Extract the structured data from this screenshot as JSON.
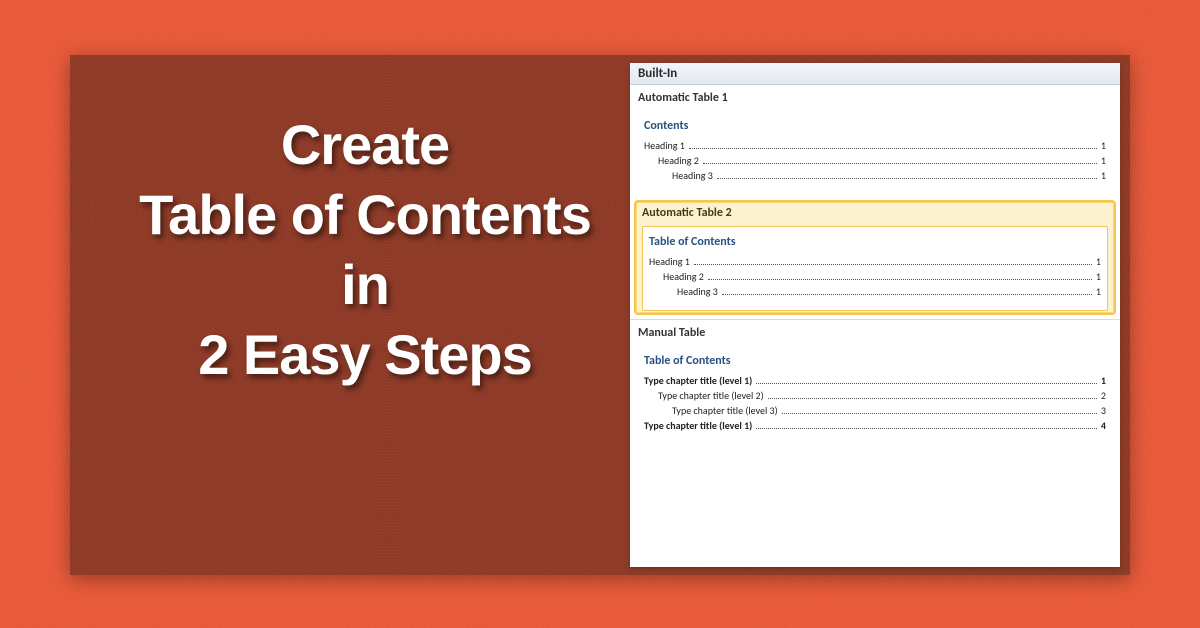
{
  "headline": {
    "l1": "Create",
    "l2": "Table of Contents",
    "l3": "in",
    "l4": "2 Easy Steps"
  },
  "gallery": {
    "header": "Built-In",
    "styles": [
      {
        "title": "Automatic Table 1",
        "preview_title": "Contents",
        "lines": [
          {
            "text": "Heading 1",
            "page": "1",
            "indent": 0,
            "bold": false
          },
          {
            "text": "Heading 2",
            "page": "1",
            "indent": 1,
            "bold": false
          },
          {
            "text": "Heading 3",
            "page": "1",
            "indent": 2,
            "bold": false
          }
        ],
        "selected": false
      },
      {
        "title": "Automatic Table 2",
        "preview_title": "Table of Contents",
        "lines": [
          {
            "text": "Heading 1",
            "page": "1",
            "indent": 0,
            "bold": false
          },
          {
            "text": "Heading 2",
            "page": "1",
            "indent": 1,
            "bold": false
          },
          {
            "text": "Heading 3",
            "page": "1",
            "indent": 2,
            "bold": false
          }
        ],
        "selected": true
      },
      {
        "title": "Manual Table",
        "preview_title": "Table of Contents",
        "lines": [
          {
            "text": "Type chapter title (level 1)",
            "page": "1",
            "indent": 0,
            "bold": true
          },
          {
            "text": "Type chapter title (level 2)",
            "page": "2",
            "indent": 1,
            "bold": false
          },
          {
            "text": "Type chapter title (level 3)",
            "page": "3",
            "indent": 2,
            "bold": false
          },
          {
            "text": "Type chapter title (level 1)",
            "page": "4",
            "indent": 0,
            "bold": true
          }
        ],
        "selected": false
      }
    ]
  }
}
